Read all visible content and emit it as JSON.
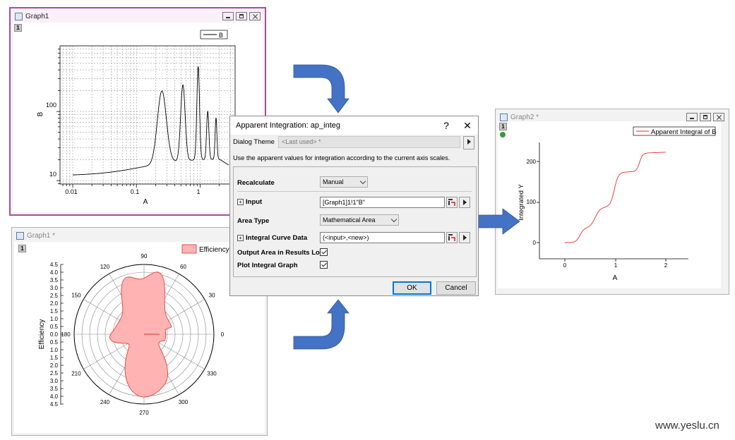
{
  "graph1_top": {
    "title": "Graph1",
    "layer": "1",
    "legend": "B",
    "xlabel": "A",
    "ylabel": "B",
    "xticks": [
      "0.01",
      "0.1",
      "1"
    ],
    "yticks": [
      "10",
      "100"
    ]
  },
  "graph1_polar": {
    "title": "Graph1 *",
    "layer": "1",
    "legend": "Efficiency",
    "ylabel": "Efficiency",
    "angles": [
      "90",
      "60",
      "30",
      "0",
      "330",
      "300",
      "270",
      "240",
      "210",
      "180",
      "150",
      "120"
    ],
    "radial_ticks_top": [
      "4.5",
      "4.0",
      "3.5",
      "3.0",
      "2.5",
      "2.0",
      "1.5",
      "1.0",
      "0.5",
      "0.0"
    ],
    "radial_ticks_bottom": [
      "0.5",
      "1.0",
      "1.5",
      "2.0",
      "2.5",
      "3.0",
      "3.5",
      "4.0",
      "4.5"
    ],
    "colors": {
      "fill": "#ffb3b3",
      "line": "#e03030"
    }
  },
  "graph2": {
    "title": "Graph2 *",
    "layer": "1",
    "legend": "Apparent Integral of B",
    "xlabel": "A",
    "ylabel": "Integrated Y",
    "xticks": [
      "0",
      "1",
      "2"
    ],
    "yticks": [
      "0",
      "100",
      "200"
    ],
    "line_color": "#e03030"
  },
  "dialog": {
    "title": "Apparent Integration: ap_integ",
    "help": "?",
    "close": "✕",
    "theme_label": "Dialog Theme",
    "theme_value": "<Last used> *",
    "description": "Use the apparent values for integration according to the current axis scales.",
    "recalculate_label": "Recalculate",
    "recalculate_value": "Manual",
    "input_label": "Input",
    "input_value": "[Graph1]1!1\"B\"",
    "area_type_label": "Area Type",
    "area_type_value": "Mathematical Area",
    "integral_curve_label": "Integral Curve Data",
    "integral_curve_value": "(<input>,<new>)",
    "output_area_label": "Output Area in Results Log",
    "plot_integral_label": "Plot Integral Graph",
    "ok": "OK",
    "cancel": "Cancel"
  },
  "watermark": "www.yeslu.cn",
  "colors": {
    "arrow": "#4472c4",
    "active_frame": "#a4509c",
    "inactive_frame": "#b0b0b0"
  }
}
